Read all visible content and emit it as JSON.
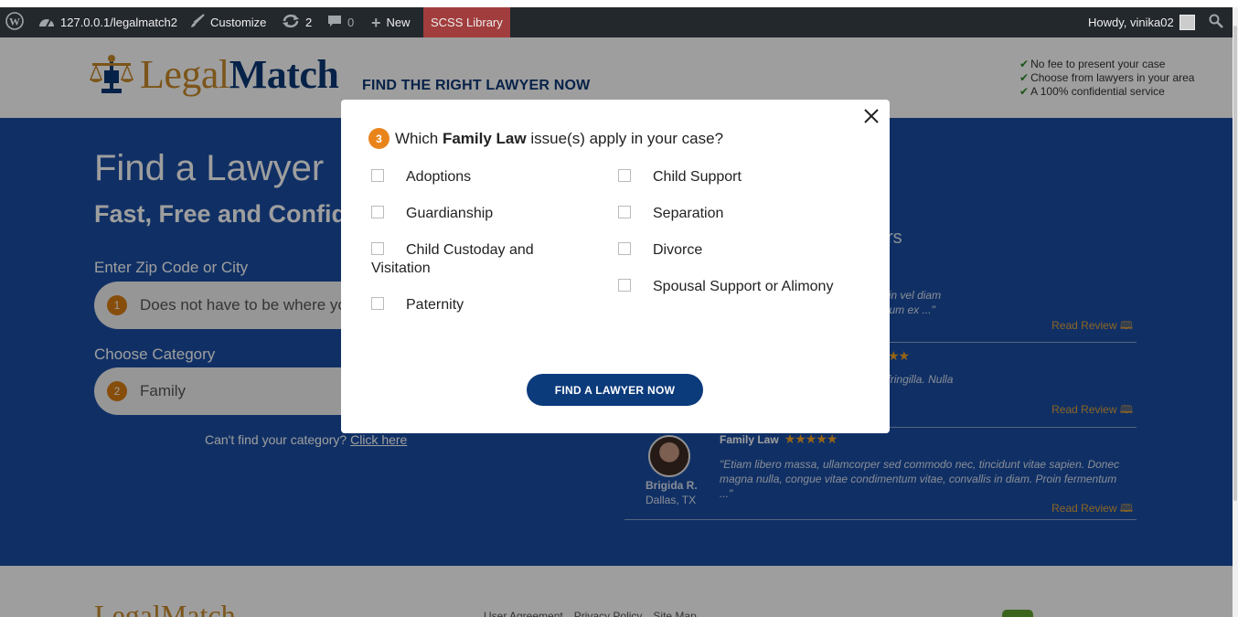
{
  "admin_bar": {
    "site_url": "127.0.0.1/legalmatch2",
    "customize": "Customize",
    "updates_count": "2",
    "comments_count": "0",
    "new_label": "New",
    "scss_library": "SCSS Library",
    "howdy": "Howdy, vinika02",
    "icons": [
      "wordpress-icon",
      "dashboard-icon",
      "brush-icon",
      "updates-icon",
      "comments-icon",
      "plus-icon",
      "avatar",
      "search-icon"
    ]
  },
  "header": {
    "logo_legal": "Legal",
    "logo_match": "Match",
    "tagline": "FIND THE RIGHT LAWYER NOW",
    "benefits": [
      "No fee to present your case",
      "Choose from lawyers in your area",
      "A 100% confidential service"
    ]
  },
  "hero": {
    "title": "Find a Lawyer",
    "subtitle": "Fast, Free and Confid",
    "zip_label": "Enter Zip Code or City",
    "zip_step": "1",
    "zip_placeholder": "Does not have to be where yo",
    "category_label": "Choose Category",
    "category_step": "2",
    "category_value": "Family",
    "cant_find_text": "Can't find your category?",
    "cant_find_link": "Click here"
  },
  "reviews": {
    "heading_fragment": "rs",
    "items": [
      {
        "text": "drerit. Integer tortor diam, sollicitudin vel diam\nce eu faucibus velit. Nullam bibendum ex ...\"",
        "link": "Read Review"
      },
      {
        "stars": "★★",
        "text": "ula facilisis. Donec interdum porta fringilla. Nulla\ns nisi lobortis, non ornare est co...\"",
        "link": "Read Review"
      },
      {
        "category": "Family Law",
        "stars": "★★★★★",
        "text": "\"Etiam libero massa, ullamcorper sed commodo nec, tincidunt vitae sapien. Donec magna nulla, congue vitae condimentum vitae, convallis in diam. Proin fermentum ...\"",
        "name": "Brigida R.",
        "location": "Dallas, TX",
        "link": "Read Review"
      }
    ]
  },
  "footer": {
    "logo": "LegalMatch",
    "links": [
      "User Agreement",
      "Privacy Policy",
      "Site Map"
    ]
  },
  "modal": {
    "step": "3",
    "question_pre": "Which",
    "question_bold": "Family Law",
    "question_post": "issue(s) apply in your case?",
    "options_left": [
      "Adoptions",
      "Guardianship",
      "Child Custoday and Visitation",
      "Paternity"
    ],
    "options_right": [
      "Child Support",
      "Separation",
      "Divorce",
      "Spousal Support or Alimony"
    ],
    "submit_label": "FIND A LAWYER NOW"
  },
  "colors": {
    "admin_bar": "#23282d",
    "hero_blue": "#1b4ea4",
    "brand_navy": "#0c3775",
    "brand_gold": "#c9892a",
    "step_orange": "#e9841b",
    "button_navy": "#0c3b7c"
  }
}
